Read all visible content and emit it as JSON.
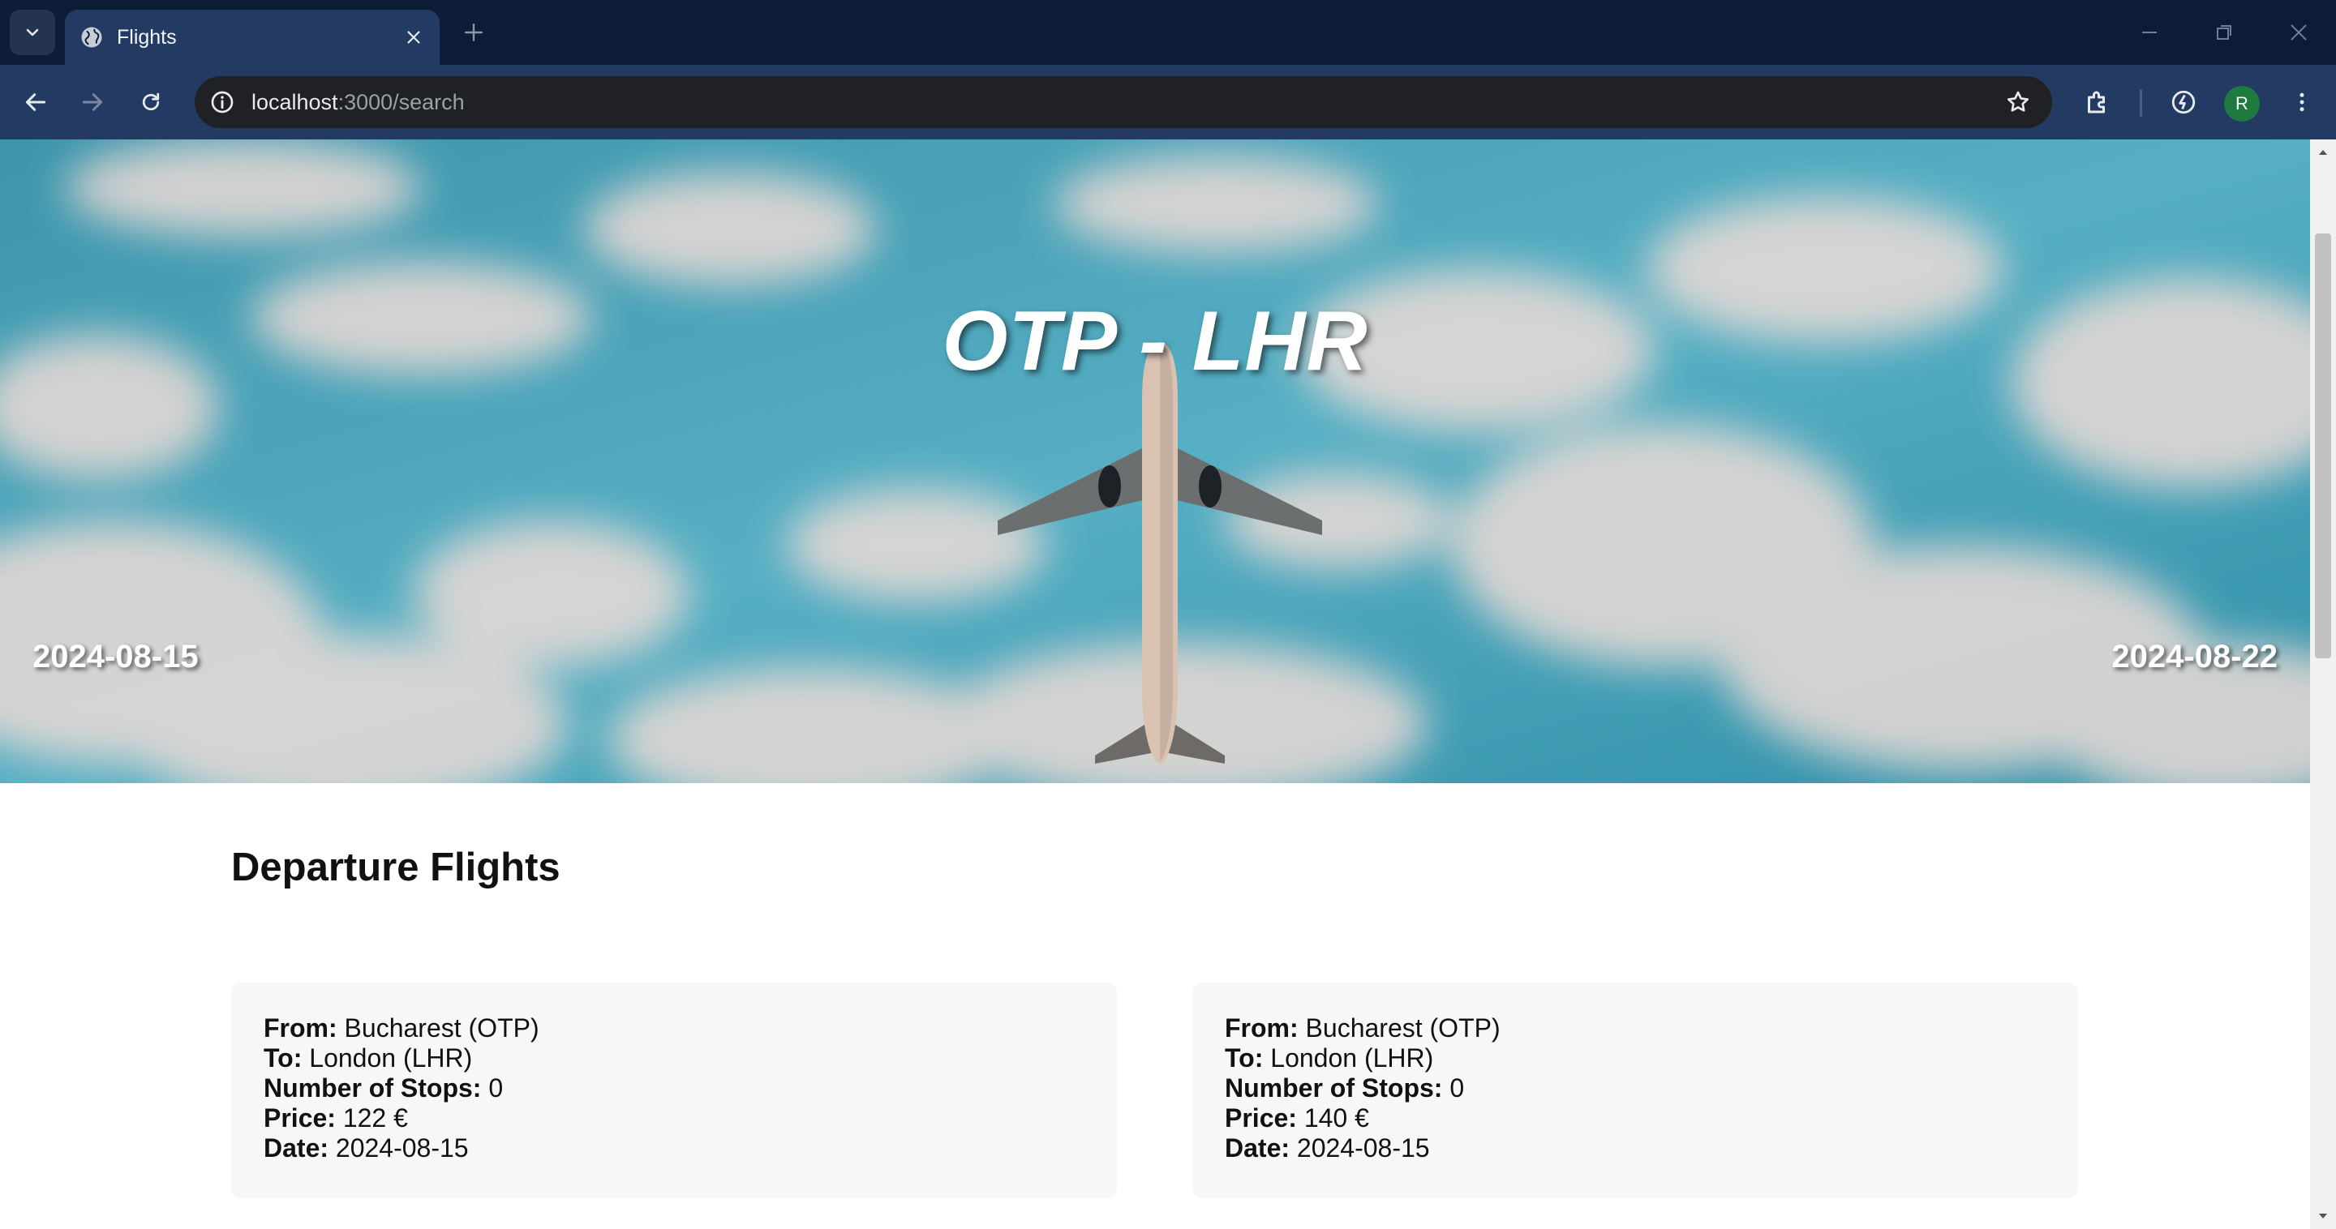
{
  "browser": {
    "tab_title": "Flights",
    "url_host": "localhost",
    "url_path": ":3000/search",
    "profile_initial": "R",
    "icons": [
      "tab-search-icon",
      "globe-icon",
      "close-icon",
      "plus-icon",
      "minimize-icon",
      "restore-icon",
      "window-close-icon",
      "back-arrow-icon",
      "forward-arrow-icon",
      "reload-icon",
      "site-info-icon",
      "star-icon",
      "extensions-icon",
      "performance-icon",
      "kebab-menu-icon"
    ]
  },
  "hero": {
    "route": "OTP - LHR",
    "departure_date": "2024-08-15",
    "return_date": "2024-08-22"
  },
  "departure_section": {
    "title": "Departure Flights",
    "labels": {
      "from": "From:",
      "to": "To:",
      "stops": "Number of Stops:",
      "price": "Price:",
      "date": "Date:"
    },
    "flights": [
      {
        "from": "Bucharest (OTP)",
        "to": "London (LHR)",
        "stops": "0",
        "price": "122 €",
        "date": "2024-08-15"
      },
      {
        "from": "Bucharest (OTP)",
        "to": "London (LHR)",
        "stops": "0",
        "price": "140 €",
        "date": "2024-08-15"
      }
    ]
  },
  "colors": {
    "tabstrip": "#0c1c36",
    "toolbar": "#233a63",
    "sky": "#4aa6bd",
    "card_bg": "#f7f7f7"
  }
}
